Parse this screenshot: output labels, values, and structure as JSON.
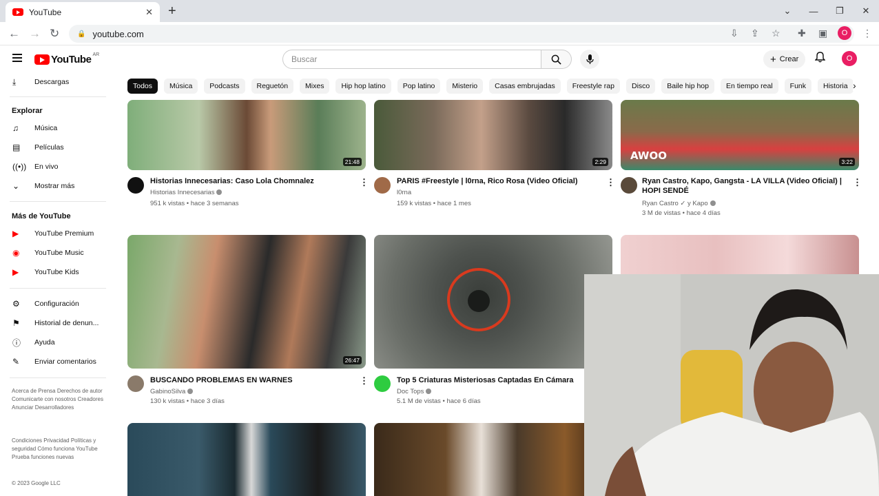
{
  "browser": {
    "tab_title": "YouTube",
    "address": "youtube.com",
    "profile_initial": "O"
  },
  "header": {
    "logo_text": "YouTube",
    "country_code": "AR",
    "search_placeholder": "Buscar",
    "create_label": "Crear",
    "avatar_initial": "O"
  },
  "chips": [
    "Todos",
    "Música",
    "Podcasts",
    "Reguetón",
    "Mixes",
    "Hip hop latino",
    "Pop latino",
    "Misterio",
    "Casas embrujadas",
    "Freestyle rap",
    "Disco",
    "Baile hip hop",
    "En tiempo real",
    "Funk",
    "Historia"
  ],
  "sidebar": {
    "downloads": "Descargas",
    "explore_heading": "Explorar",
    "explore": [
      "Música",
      "Películas",
      "En vivo",
      "Mostrar más"
    ],
    "more_heading": "Más de YouTube",
    "more": [
      "YouTube Premium",
      "YouTube Music",
      "YouTube Kids"
    ],
    "settings": [
      "Configuración",
      "Historial de denun...",
      "Ayuda",
      "Enviar comentarios"
    ],
    "footer1": "Acerca de  Prensa  Derechos de autor  Comunicarte con nosotros  Creadores  Anunciar  Desarrolladores",
    "footer2": "Condiciones  Privacidad  Políticas y seguridad  Cómo funciona YouTube  Prueba funciones nuevas",
    "copyright": "© 2023 Google LLC"
  },
  "videos": [
    {
      "title": "Historias Innecesarias: Caso Lola Chomnalez",
      "channel": "Historias Innecesarias",
      "stats": "951 k vistas • hace 3 semanas",
      "duration": "21:48"
    },
    {
      "title": "PARIS #Freestyle | l0rna, Rico Rosa (Video Oficial)",
      "channel": "l0rna",
      "stats": "159 k vistas • hace 1 mes",
      "duration": "2:29"
    },
    {
      "title": "Ryan Castro, Kapo, Gangsta - LA VILLA (Video Oficial) | HOPI SENDÉ",
      "channel": "Ryan Castro ✓ y Kapo",
      "stats": "3 M de vistas • hace 4 días",
      "duration": "3:22",
      "overlay_text": "AWOO"
    },
    {
      "title": "BUSCANDO PROBLEMAS EN WARNES",
      "channel": "GabinoSilva",
      "stats": "130 k vistas • hace 3 días",
      "duration": "26:47"
    },
    {
      "title": "Top 5 Criaturas Misteriosas Captadas En Cámara",
      "channel": "Doc Tops",
      "stats": "5.1 M de vistas • hace 6 días",
      "duration": ""
    }
  ]
}
